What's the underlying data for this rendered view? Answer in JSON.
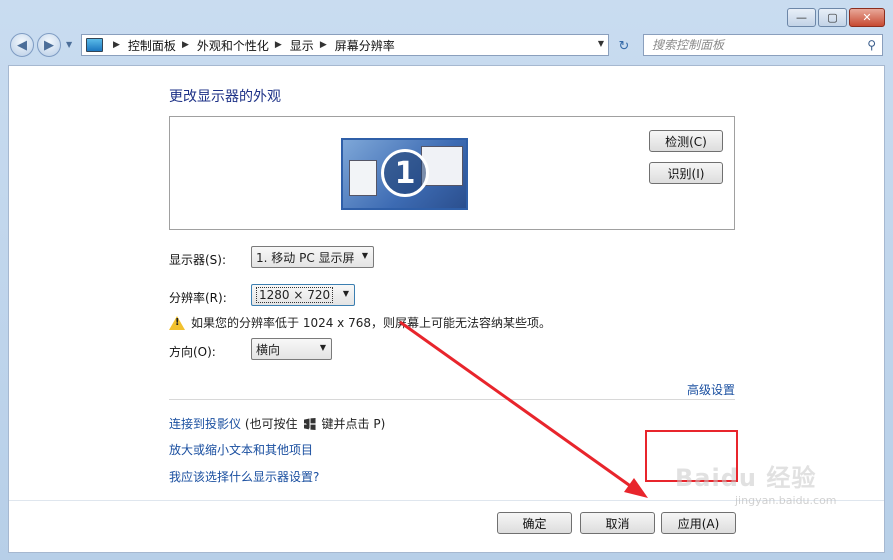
{
  "window": {
    "min_label": "—",
    "max_label": "▢",
    "close_label": "✕"
  },
  "address": {
    "crumbs": [
      "控制面板",
      "外观和个性化",
      "显示",
      "屏幕分辨率"
    ]
  },
  "search": {
    "placeholder": "搜索控制面板"
  },
  "page": {
    "title": "更改显示器的外观",
    "monitor_number": "1",
    "detect_button": "检测(C)",
    "identify_button": "识别(I)",
    "display_label": "显示器(S):",
    "display_value": "1. 移动 PC 显示屏",
    "resolution_label": "分辨率(R):",
    "resolution_value": "1280 × 720",
    "warning_text": "如果您的分辨率低于 1024 x 768，则屏幕上可能无法容纳某些项。",
    "orientation_label": "方向(O):",
    "orientation_value": "横向",
    "advanced_link": "高级设置",
    "projector_link": "连接到投影仪",
    "projector_note_before": "(也可按住",
    "projector_note_after": "键并点击 P)",
    "zoom_link": "放大或缩小文本和其他项目",
    "help_link": "我应该选择什么显示器设置?"
  },
  "footer": {
    "ok_button": "确定",
    "cancel_button": "取消",
    "apply_button": "应用(A)"
  },
  "watermark": {
    "brand": "Baidu 经验",
    "url": "jingyan.baidu.com"
  },
  "colors": {
    "highlight": "#e8252c",
    "link": "#1a4fa0",
    "title": "#1e3287"
  }
}
